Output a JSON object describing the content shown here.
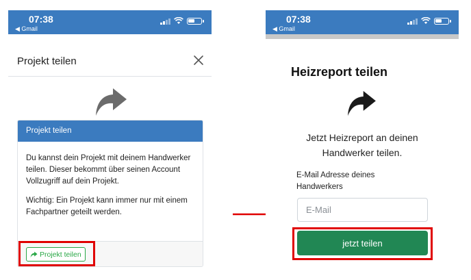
{
  "status_bar": {
    "time": "07:38",
    "back_label": "◀ Gmail"
  },
  "left_screen": {
    "modal_title": "Projekt teilen",
    "close_icon": "close-icon",
    "card": {
      "header": "Projekt teilen",
      "paragraph_1": "Du kannst dein Projekt mit deinem Handwerker teilen. Dieser bekommt über seinen Account Vollzugriff auf dein Projekt.",
      "paragraph_2": "Wichtig: Ein Projekt kann immer nur mit einem Fachpartner geteilt werden.",
      "button_label": "Projekt teilen"
    }
  },
  "right_screen": {
    "title": "Heizreport teilen",
    "subtitle_line_1": "Jetzt Heizreport an deinen",
    "subtitle_line_2": "Handwerker teilen.",
    "email_label_line_1": "E-Mail Adresse deines",
    "email_label_line_2": "Handwerkers",
    "email_placeholder": "E-Mail",
    "email_value": "",
    "submit_label": "jetzt teilen"
  },
  "colors": {
    "status_bar": "#3b7bbf",
    "card_header": "#3b7bbf",
    "outline_button": "#28a745",
    "primary_button": "#218754",
    "highlight": "#e00000"
  }
}
